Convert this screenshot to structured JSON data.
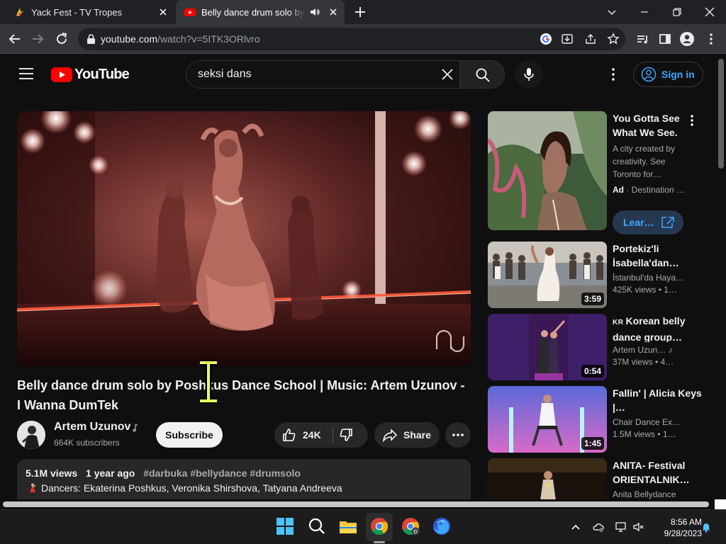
{
  "browser": {
    "tabs": [
      {
        "title": "Yack Fest - TV Tropes",
        "active": false
      },
      {
        "title": "Belly dance drum solo by Po",
        "active": true,
        "audio_playing": true
      }
    ],
    "url_host": "youtube.com",
    "url_path": "/watch?v=5ITK3ORlvro"
  },
  "youtube": {
    "logo_text": "YouTube",
    "search_value": "seksi dans",
    "sign_in_label": "Sign in"
  },
  "video": {
    "title": "Belly dance drum solo by Poshkus Dance School | Music: Artem Uzunov - I Wanna DumTek",
    "channel_name": "Artem Uzunov",
    "subscribers": "664K subscribers",
    "subscribe_label": "Subscribe",
    "likes": "24K",
    "share_label": "Share",
    "views": "5.1M views",
    "age": "1 year ago",
    "hashtags": "#darbuka #bellydance #drumsolo",
    "description_line": "Dancers: Ekaterina Poshkus, Veronika Shirshova, Tatyana Andreeva"
  },
  "sidebar": {
    "ad": {
      "title": "You Gotta See What We See.",
      "description": "A city created by creativity. See Toronto for…",
      "ad_label": "Ad",
      "ad_source": "Destination …",
      "cta": "Lear…"
    },
    "videos": [
      {
        "title": "Portekiz'li İsabella'dan…",
        "channel": "İstanbul'da Hayat…",
        "meta": "425K views • 1…",
        "duration": "3:59"
      },
      {
        "prefix": "KR",
        "title": "Korean belly dance group…",
        "channel": "Artem Uzun…",
        "meta": "37M views • 4…",
        "duration": "0:54"
      },
      {
        "title": "Fallin' | Alicia Keys |…",
        "channel": "Chair Dance Expr…",
        "meta": "1.5M views • 1…",
        "duration": "1:45"
      },
      {
        "title": "ANITA- Festival ORIENTALNIK…",
        "channel": "Anita Bellydance",
        "meta": "",
        "duration": ""
      }
    ]
  },
  "taskbar": {
    "time": "8:56 AM",
    "date": "9/28/2023"
  },
  "colors": {
    "youtube_red": "#ff0000",
    "link_blue": "#3ea6ff",
    "background": "#0f0f0f"
  }
}
